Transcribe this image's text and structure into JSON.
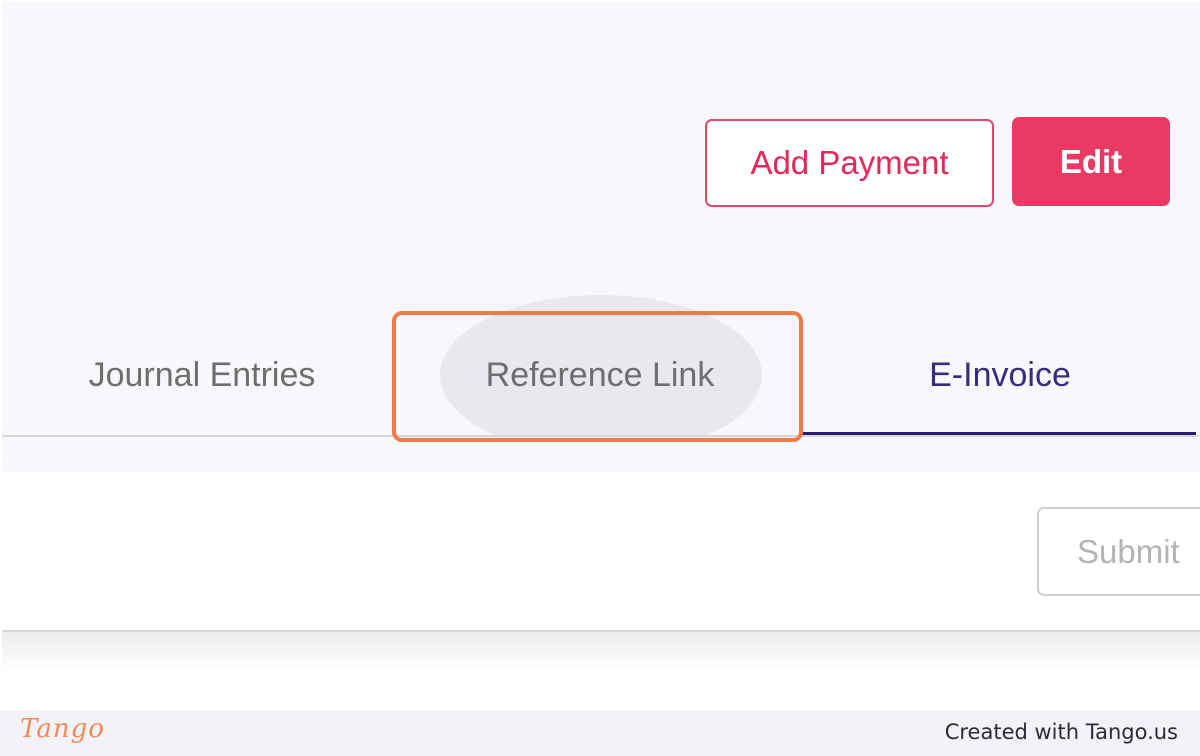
{
  "header": {
    "add_payment_label": "Add Payment",
    "edit_label": "Edit"
  },
  "tabs": [
    {
      "label": "Journal Entries",
      "active": false
    },
    {
      "label": "Reference Link",
      "active": false,
      "highlighted": true
    },
    {
      "label": "E-Invoice",
      "active": true
    }
  ],
  "panel": {
    "submit_label": "Submit"
  },
  "footer": {
    "logo_text": "Tango",
    "credit_text": "Created with Tango.us"
  },
  "colors": {
    "accent": "#ea3a64",
    "active_tab": "#2c1f6e",
    "highlight": "#f47a4b"
  }
}
